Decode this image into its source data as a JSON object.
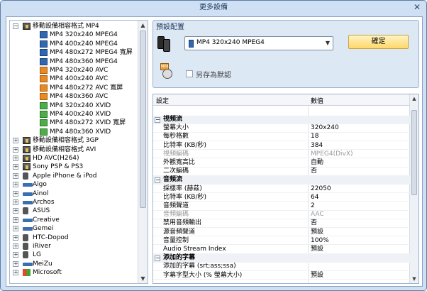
{
  "window": {
    "title": "更多設備",
    "close_glyph": "✕"
  },
  "tree": {
    "items": [
      {
        "label": "移動設備相容格式 MP4",
        "level": 0,
        "expander": "−",
        "icon": "film-icon"
      },
      {
        "label": "MP4 320x240 MPEG4",
        "level": 1,
        "icon": "mp4-icon"
      },
      {
        "label": "MP4 400x240 MPEG4",
        "level": 1,
        "icon": "mp4-icon"
      },
      {
        "label": "MP4 480x272 MPEG4 寬屏",
        "level": 1,
        "icon": "mp4-icon"
      },
      {
        "label": "MP4 480x360 MPEG4",
        "level": 1,
        "icon": "mp4-icon"
      },
      {
        "label": "MP4 320x240 AVC",
        "level": 1,
        "icon": "avc-icon"
      },
      {
        "label": "MP4 400x240 AVC",
        "level": 1,
        "icon": "avc-icon"
      },
      {
        "label": "MP4 480x272 AVC 寬屏",
        "level": 1,
        "icon": "avc-icon"
      },
      {
        "label": "MP4 480x360 AVC",
        "level": 1,
        "icon": "avc-icon"
      },
      {
        "label": "MP4 320x240 XVID",
        "level": 1,
        "icon": "xvid-icon"
      },
      {
        "label": "MP4 400x240 XVID",
        "level": 1,
        "icon": "xvid-icon"
      },
      {
        "label": "MP4 480x272 XVID 寬屏",
        "level": 1,
        "icon": "xvid-icon"
      },
      {
        "label": "MP4 480x360 XVID",
        "level": 1,
        "icon": "xvid-icon"
      },
      {
        "label": "移動設備相容格式 3GP",
        "level": 0,
        "expander": "+",
        "icon": "film-icon"
      },
      {
        "label": "移動設備相容格式 AVI",
        "level": 0,
        "expander": "+",
        "icon": "film-icon"
      },
      {
        "label": "HD AVC(H264)",
        "level": 0,
        "expander": "+",
        "icon": "hd-icon"
      },
      {
        "label": "Sony PSP & PS3",
        "level": 0,
        "expander": "+",
        "icon": "psp-icon"
      },
      {
        "label": "Apple iPhone & iPod",
        "level": 0,
        "expander": "+",
        "icon": "iphone-icon"
      },
      {
        "label": "Aigo",
        "level": 0,
        "expander": "+",
        "icon": "player-icon"
      },
      {
        "label": "Ainol",
        "level": 0,
        "expander": "+",
        "icon": "player-icon"
      },
      {
        "label": "Archos",
        "level": 0,
        "expander": "+",
        "icon": "player-icon"
      },
      {
        "label": "ASUS",
        "level": 0,
        "expander": "+",
        "icon": "device-icon"
      },
      {
        "label": "Creative",
        "level": 0,
        "expander": "+",
        "icon": "player-icon"
      },
      {
        "label": "Gemei",
        "level": 0,
        "expander": "+",
        "icon": "player-icon"
      },
      {
        "label": "HTC-Dopod",
        "level": 0,
        "expander": "+",
        "icon": "device-icon"
      },
      {
        "label": "iRiver",
        "level": 0,
        "expander": "+",
        "icon": "device-icon"
      },
      {
        "label": "LG",
        "level": 0,
        "expander": "+",
        "icon": "device-icon"
      },
      {
        "label": "MeiZu",
        "level": 0,
        "expander": "+",
        "icon": "player-icon"
      },
      {
        "label": "Microsoft",
        "level": 0,
        "expander": "+",
        "icon": "windows-icon"
      }
    ]
  },
  "preset": {
    "title": "預設配置",
    "selected": "MP4 320x240 MPEG4",
    "ok_label": "確定",
    "save_default_label": "另存為默認"
  },
  "grid": {
    "col_setting": "設定",
    "col_value": "數值",
    "rows": [
      {
        "type": "sec",
        "key": "視頻流"
      },
      {
        "key": "螢幕大小",
        "value": "320x240"
      },
      {
        "key": "每秒格數",
        "value": "18"
      },
      {
        "key": "比特率 (KB/秒)",
        "value": "384"
      },
      {
        "key": "視頻編碼",
        "value": "MPEG4(DivX)",
        "disabled": true
      },
      {
        "key": "外觀寬高比",
        "value": "自動"
      },
      {
        "key": "二次編碼",
        "value": "否"
      },
      {
        "type": "sec",
        "key": "音頻流"
      },
      {
        "key": "採樣率 (赫茲)",
        "value": "22050"
      },
      {
        "key": "比特率 (KB/秒)",
        "value": "64"
      },
      {
        "key": "音頻聲道",
        "value": "2"
      },
      {
        "key": "音頻編碼",
        "value": "AAC",
        "disabled": true
      },
      {
        "key": "禁用音頻輸出",
        "value": "否"
      },
      {
        "key": "源音頻聲道",
        "value": "預設"
      },
      {
        "key": "音量控制",
        "value": "100%"
      },
      {
        "key": "Audio Stream Index",
        "value": "預設"
      },
      {
        "type": "sec",
        "key": "添加的字幕"
      },
      {
        "key": "添加的字幕 (srt;ass;ssa)",
        "value": ""
      },
      {
        "key": "字幕字型大小 (% 螢幕大小)",
        "value": "預設"
      }
    ]
  },
  "colors": {
    "accent": "#2f67b5",
    "ok_button": "#ffd86a",
    "frame": "#cfe0f4"
  }
}
